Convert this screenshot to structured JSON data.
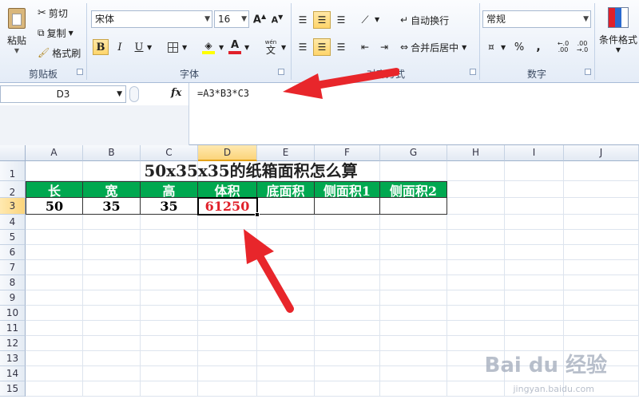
{
  "clipboard": {
    "paste": "粘贴",
    "cut": "剪切",
    "copy": "复制",
    "format_painter": "格式刷",
    "group": "剪贴板"
  },
  "font": {
    "name": "宋体",
    "size": "16",
    "bold": "B",
    "italic": "I",
    "underline": "U",
    "phonetic": "wén",
    "group": "字体"
  },
  "alignment": {
    "wrap": "自动换行",
    "merge": "合并后居中",
    "group": "对齐方式"
  },
  "number": {
    "format": "常规",
    "percent": "%",
    "comma": ",",
    "group": "数字"
  },
  "styles": {
    "conditional": "条件格式"
  },
  "formula_bar": {
    "name_box": "D3",
    "fx": "fx",
    "formula": "=A3*B3*C3"
  },
  "columns": [
    "A",
    "B",
    "C",
    "D",
    "E",
    "F",
    "G",
    "H",
    "I",
    "J"
  ],
  "rows": [
    "1",
    "2",
    "3",
    "4",
    "5",
    "6",
    "7",
    "8",
    "9",
    "10",
    "11",
    "12",
    "13",
    "14",
    "15"
  ],
  "sheet": {
    "title": "50x35x35的纸箱面积怎么算",
    "headers": [
      "长",
      "宽",
      "高",
      "体积",
      "底面积",
      "侧面积1",
      "侧面积2"
    ],
    "values": [
      "50",
      "35",
      "35",
      "61250"
    ]
  },
  "watermark": {
    "brand": "Bai du 经验",
    "url": "jingyan.baidu.com"
  },
  "colors": {
    "header_green": "#00a850",
    "result_red": "#e0202a",
    "arrow_red": "#e8262b"
  }
}
